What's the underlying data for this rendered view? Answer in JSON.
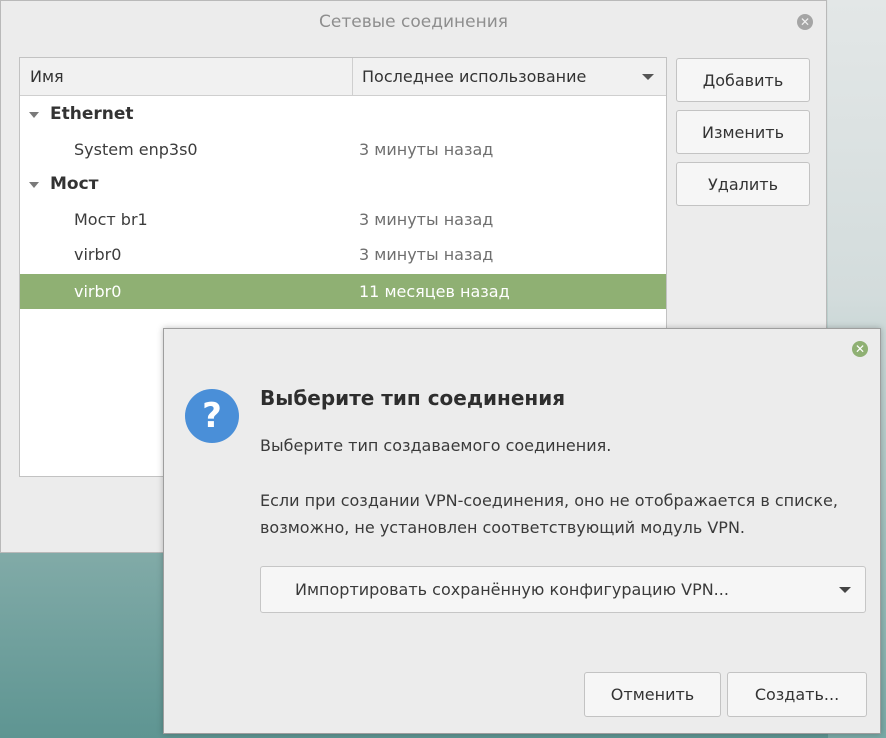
{
  "main_window": {
    "title": "Сетевые соединения",
    "close_glyph": "✕",
    "columns": {
      "name": "Имя",
      "last_used": "Последнее использование"
    },
    "groups": [
      {
        "label": "Ethernet",
        "items": [
          {
            "name": "System enp3s0",
            "last_used": "3 минуты назад"
          }
        ]
      },
      {
        "label": "Мост",
        "items": [
          {
            "name": "Мост br1",
            "last_used": "3 минуты назад"
          },
          {
            "name": "virbr0",
            "last_used": "3 минуты назад"
          },
          {
            "name": "virbr0",
            "last_used": "11 месяцев назад",
            "selected": true
          }
        ]
      }
    ],
    "buttons": {
      "add": "Добавить",
      "edit": "Изменить",
      "delete": "Удалить"
    }
  },
  "dialog": {
    "close_glyph": "✕",
    "icon": "question-icon",
    "icon_glyph": "?",
    "heading": "Выберите тип соединения",
    "text1": "Выберите тип создаваемого соединения.",
    "text2": "Если при создании VPN-соединения, оно не отображается в списке, возможно, не установлен соответствующий модуль VPN.",
    "combo_value": "Импортировать сохранённую конфигурацию VPN...",
    "buttons": {
      "cancel": "Отменить",
      "create": "Создать..."
    }
  },
  "colors": {
    "selection": "#8fb073",
    "question_icon": "#4a8fd8"
  }
}
